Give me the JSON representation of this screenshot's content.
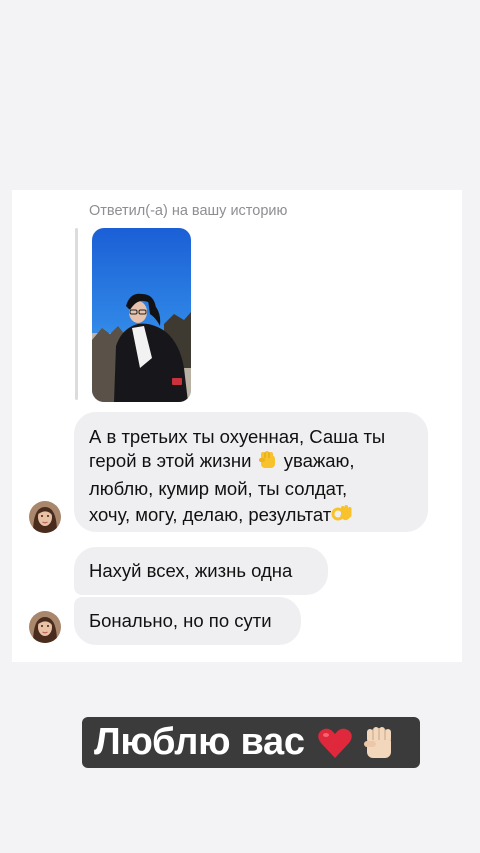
{
  "conversation": {
    "reply_label": "Ответил(-а) на вашу историю",
    "message_1_lines": [
      "А в третьих ты охуенная, Саша ты",
      "герой в этой жизни",
      "уважаю,",
      "люблю, кумир мой, ты солдат,",
      "хочу, могу, делаю, результат"
    ],
    "message_2": "Нахуй всех, жизнь одна",
    "message_3": "Бонально, но по сути"
  },
  "caption": {
    "text": "Люблю вас"
  },
  "icons": {
    "fist_inline": "raised-fist-icon",
    "ok_hand_inline": "ok-hand-icon",
    "heart": "red-heart-icon",
    "fist_caption": "raised-fist-light-icon"
  },
  "colors": {
    "background": "#f3f3f5",
    "card": "#ffffff",
    "bubble": "#efeff2",
    "caption_box": "#3b3b3b",
    "heart": "#e0283c"
  }
}
